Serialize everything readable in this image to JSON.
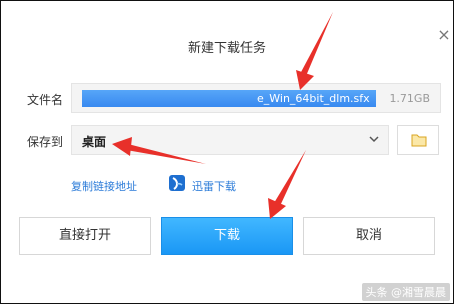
{
  "dialog": {
    "title": "新建下载任务",
    "close_glyph": "×"
  },
  "filename": {
    "label": "文件名",
    "value": "e_Win_64bit_dlm.sfx",
    "size": "1.71GB"
  },
  "saveto": {
    "label": "保存到",
    "value": "桌面"
  },
  "links": {
    "copy_link": "复制链接地址",
    "xunlei": "迅雷下载"
  },
  "buttons": {
    "direct_open": "直接打开",
    "download": "下载",
    "cancel": "取消"
  },
  "watermark": "头条 @湘雪晨晨",
  "colors": {
    "accent": "#1a97f5",
    "link": "#2b7bd8",
    "annotation_arrow": "#e8302a"
  },
  "icons": {
    "close": "close-icon",
    "dropdown": "chevron-down-icon",
    "folder": "folder-icon",
    "xunlei": "xunlei-logo-icon"
  }
}
